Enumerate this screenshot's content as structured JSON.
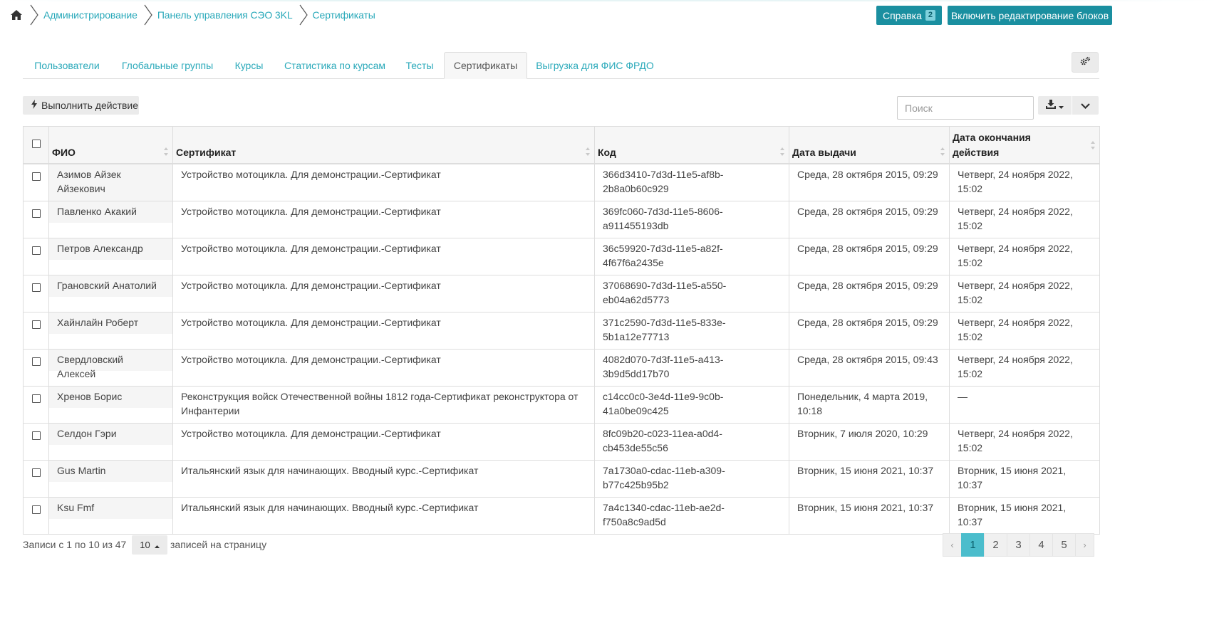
{
  "breadcrumb": {
    "items": [
      "Администрирование",
      "Панель управления СЭО 3KL",
      "Сертификаты"
    ]
  },
  "header": {
    "help_label": "Справка",
    "help_badge": "2",
    "edit_label": "Включить редактирование блоков"
  },
  "tabs": [
    {
      "label": "Пользователи",
      "active": false
    },
    {
      "label": "Глобальные группы",
      "active": false
    },
    {
      "label": "Курсы",
      "active": false
    },
    {
      "label": "Статистика по курсам",
      "active": false
    },
    {
      "label": "Тесты",
      "active": false
    },
    {
      "label": "Сертификаты",
      "active": true
    },
    {
      "label": "Выгрузка для ФИС ФРДО",
      "active": false
    }
  ],
  "toolbar": {
    "action_label": "Выполнить действие",
    "search_placeholder": "Поиск"
  },
  "table": {
    "headers": {
      "name": "ФИО",
      "certificate": "Сертификат",
      "code": "Код",
      "issued": "Дата выдачи",
      "expires_line1": "Дата окончания",
      "expires_line2": "действия"
    },
    "rows": [
      {
        "name": "Азимов Айзек Айзекович",
        "certificate": "Устройство мотоцикла. Для демонстрации.-Сертификат",
        "code": "366d3410-7d3d-11e5-af8b-2b8a0b60c929",
        "issued": "Среда, 28 октября 2015, 09:29",
        "expires": "Четверг, 24 ноября 2022, 15:02"
      },
      {
        "name": "Павленко Акакий",
        "certificate": "Устройство мотоцикла. Для демонстрации.-Сертификат",
        "code": "369fc060-7d3d-11e5-8606-a911455193db",
        "issued": "Среда, 28 октября 2015, 09:29",
        "expires": "Четверг, 24 ноября 2022, 15:02"
      },
      {
        "name": "Петров Александр",
        "certificate": "Устройство мотоцикла. Для демонстрации.-Сертификат",
        "code": "36c59920-7d3d-11e5-a82f-4f67f6a2435e",
        "issued": "Среда, 28 октября 2015, 09:29",
        "expires": "Четверг, 24 ноября 2022, 15:02"
      },
      {
        "name": "Грановский Анатолий",
        "certificate": "Устройство мотоцикла. Для демонстрации.-Сертификат",
        "code": "37068690-7d3d-11e5-a550-eb04a62d5773",
        "issued": "Среда, 28 октября 2015, 09:29",
        "expires": "Четверг, 24 ноября 2022, 15:02"
      },
      {
        "name": "Хайнлайн Роберт",
        "certificate": "Устройство мотоцикла. Для демонстрации.-Сертификат",
        "code": "371c2590-7d3d-11e5-833e-5b1a12e77713",
        "issued": "Среда, 28 октября 2015, 09:29",
        "expires": "Четверг, 24 ноября 2022, 15:02"
      },
      {
        "name": "Свердловский Алексей",
        "certificate": "Устройство мотоцикла. Для демонстрации.-Сертификат",
        "code": "4082d070-7d3f-11e5-a413-3b9d5dd17b70",
        "issued": "Среда, 28 октября 2015, 09:43",
        "expires": "Четверг, 24 ноября 2022, 15:02"
      },
      {
        "name": "Хренов Борис",
        "certificate": "Реконструкция войск Отечественной войны 1812 года-Сертификат реконструктора от Инфантерии",
        "code": "c14cc0c0-3e4d-11e9-9c0b-41a0be09c425",
        "issued": "Понедельник, 4 марта 2019, 10:18",
        "expires": "—"
      },
      {
        "name": "Селдон Гэри",
        "certificate": "Устройство мотоцикла. Для демонстрации.-Сертификат",
        "code": "8fc09b20-c023-11ea-a0d4-cb453de55c56",
        "issued": "Вторник, 7 июля 2020, 10:29",
        "expires": "Четверг, 24 ноября 2022, 15:02"
      },
      {
        "name": "Gus Martin",
        "certificate": "Итальянский язык для начинающих. Вводный курс.-Сертификат",
        "code": "7a1730a0-cdac-11eb-a309-b77c425b95b2",
        "issued": "Вторник, 15 июня 2021, 10:37",
        "expires": "Вторник, 15 июня 2021, 10:37"
      },
      {
        "name": "Ksu Fmf",
        "certificate": "Итальянский язык для начинающих. Вводный курс.-Сертификат",
        "code": "7a4c1340-cdac-11eb-ae2d-f750a8c9ad5d",
        "issued": "Вторник, 15 июня 2021, 10:37",
        "expires": "Вторник, 15 июня 2021, 10:37"
      }
    ]
  },
  "footer": {
    "records_info": "Записи с 1 по 10 из 47",
    "page_size": "10",
    "page_size_label": "записей на страницу",
    "prev": "‹",
    "next": "›",
    "pages": [
      "1",
      "2",
      "3",
      "4",
      "5"
    ],
    "current_page": "1"
  },
  "colors": {
    "accent": "#1a8fa0",
    "link": "#2aa9ba",
    "active_page": "#4bbdcc"
  }
}
